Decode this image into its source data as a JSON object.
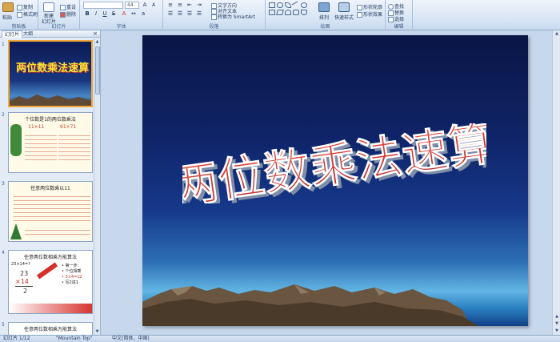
{
  "ribbon": {
    "clipboard": {
      "label": "剪贴板",
      "paste": "粘贴",
      "copy": "复制",
      "format_painter": "格式刷"
    },
    "slides": {
      "label": "幻灯片",
      "new_slide": "新建\n幻灯片",
      "reset": "重设",
      "delete": "删除"
    },
    "font": {
      "label": "字体",
      "size_value": "44"
    },
    "paragraph": {
      "label": "段落",
      "text_direction": "文字方向",
      "align_text": "对齐文本",
      "smartart": "转换为 SmartArt"
    },
    "drawing": {
      "label": "绘图",
      "arrange": "排列",
      "quick_styles": "快速样式",
      "shape_fill": "形状轮廓",
      "shape_effects": "形状效果"
    },
    "editing": {
      "label": "编辑",
      "find": "查找",
      "replace": "替换",
      "select": "选择"
    }
  },
  "left_pane": {
    "tab_slides": "幻灯片",
    "tab_outline": "大纲",
    "close": "×",
    "thumbs": [
      {
        "num": "1",
        "title": "两位数乘法速算"
      },
      {
        "num": "2",
        "title": "个位数是1的两位数乘法",
        "lines": [
          "11×11",
          "91×71"
        ]
      },
      {
        "num": "3",
        "title": "任意两位数乘以11"
      },
      {
        "num": "4",
        "title": "任意两位数相乘万能算法",
        "lines": [
          "23×14=?",
          "23",
          "×14",
          "2",
          "• 第一步：",
          "• 个位相乘",
          "• 3×4=12",
          "• 写2进1"
        ]
      },
      {
        "num": "5",
        "title": "任意两位数相乘万能算法"
      }
    ]
  },
  "slide": {
    "title": "两位数乘法速算"
  },
  "status_bar": {
    "slide_info": "幻灯片 1/12",
    "theme": "\"Mountain Top\"",
    "language": "中文(简体，中国)"
  },
  "colors": {
    "title_red": "#d23a2e",
    "title_yellow": "#f3e23c",
    "ribbon_bg": "#dbe7f5",
    "slide_top": "#0a1545",
    "slide_horizon": "#62b5e4"
  }
}
